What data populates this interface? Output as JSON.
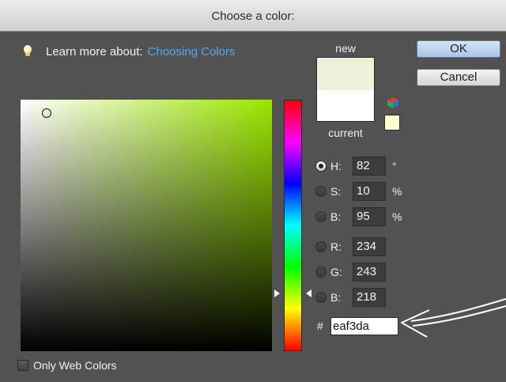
{
  "window": {
    "title": "Choose a color:"
  },
  "help": {
    "prefix": "Learn more about:",
    "link": "Choosing Colors"
  },
  "buttons": {
    "ok": "OK",
    "cancel": "Cancel"
  },
  "preview": {
    "new_label": "new",
    "current_label": "current",
    "new_color": "#eaf3da",
    "current_color": "#ffffff",
    "websafe_color": "#ffffcc"
  },
  "fields": {
    "h": {
      "label": "H:",
      "value": "82",
      "unit": "°",
      "selected": true
    },
    "s": {
      "label": "S:",
      "value": "10",
      "unit": "%",
      "selected": false
    },
    "b_hsb": {
      "label": "B:",
      "value": "95",
      "unit": "%",
      "selected": false
    },
    "r": {
      "label": "R:",
      "value": "234",
      "selected": false
    },
    "g": {
      "label": "G:",
      "value": "243",
      "selected": false
    },
    "b_rgb": {
      "label": "B:",
      "value": "218",
      "selected": false
    }
  },
  "hex": {
    "symbol": "#",
    "value": "eaf3da"
  },
  "options": {
    "only_web_colors": "Only Web Colors",
    "only_web_checked": false
  },
  "icons": {
    "bulb": "lightbulb-icon",
    "cube": "color-cube-icon",
    "arrow": "hand-drawn-arrow-annotation"
  },
  "colors": {
    "hue_base": "#9ce600",
    "dialog_bg": "#525252",
    "link": "#58a8f0"
  }
}
